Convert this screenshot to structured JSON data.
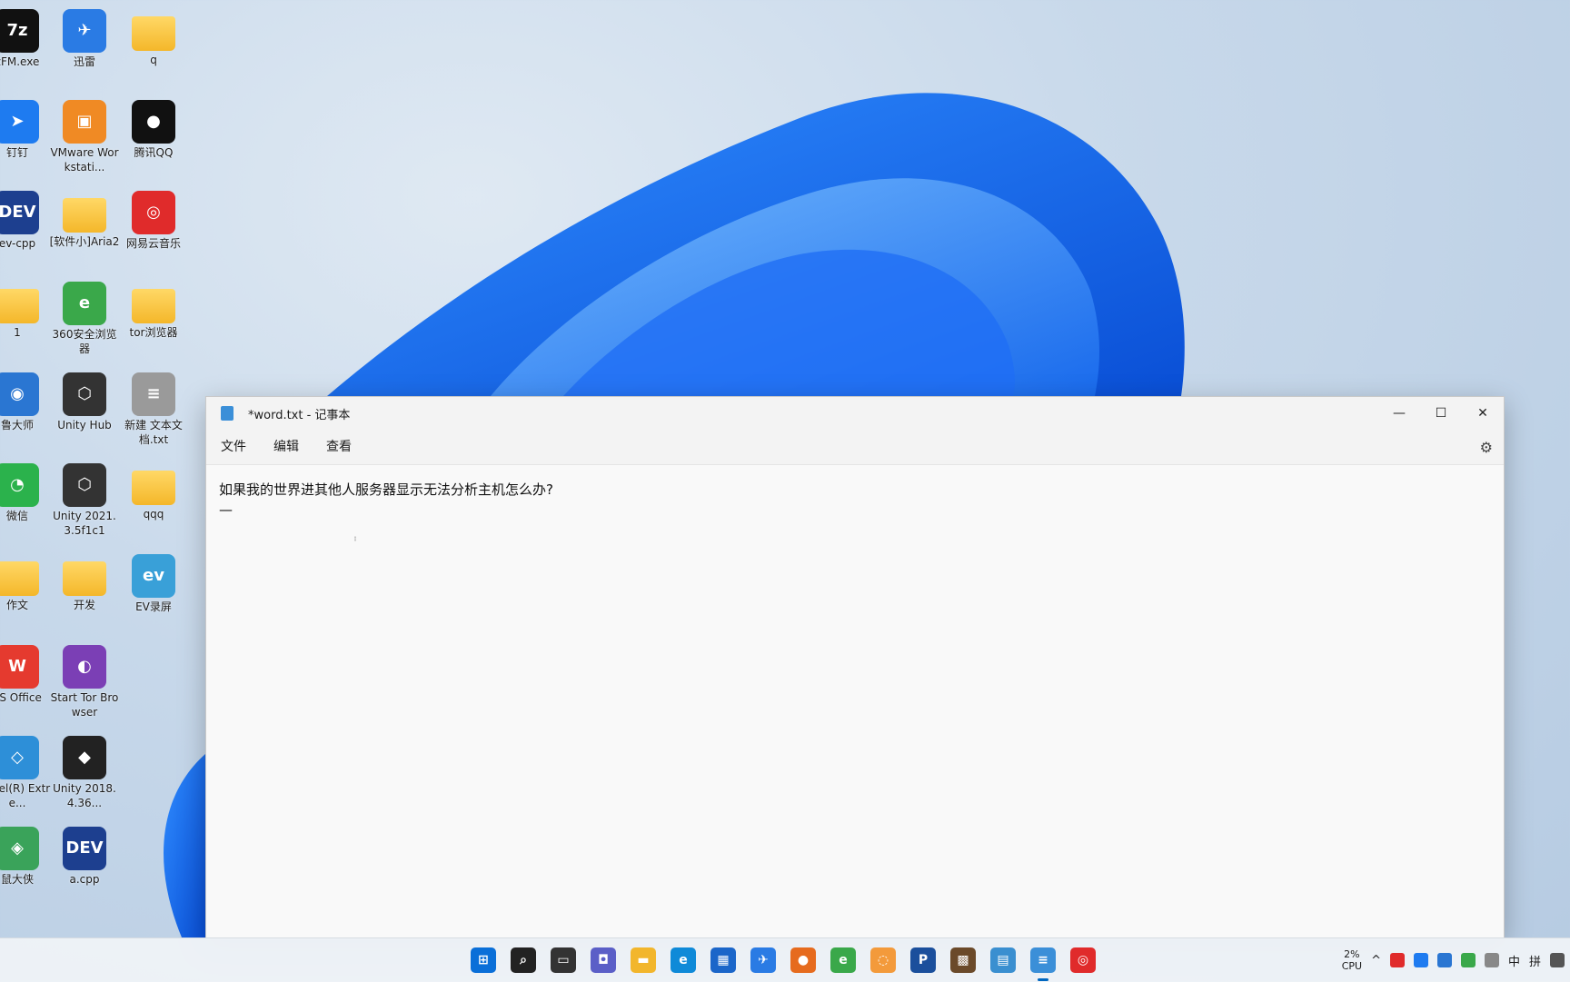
{
  "desktop": {
    "icons": [
      {
        "label": "zFM.exe",
        "glyph": "7z",
        "color": "#111111",
        "icon": "archive-icon"
      },
      {
        "label": "迅雷",
        "glyph": "✈",
        "color": "#2a7be4",
        "icon": "thunder-icon"
      },
      {
        "label": "q",
        "glyph": "",
        "color": "folder",
        "icon": "folder-icon"
      },
      {
        "label": "钉钉",
        "glyph": "➤",
        "color": "#1e7bf0",
        "icon": "dingtalk-icon"
      },
      {
        "label": "VMware Workstati...",
        "glyph": "▣",
        "color": "#f08a24",
        "icon": "vmware-icon"
      },
      {
        "label": "腾讯QQ",
        "glyph": "●",
        "color": "#111111",
        "icon": "qq-icon"
      },
      {
        "label": "ev-cpp",
        "glyph": "DEV",
        "color": "#1d3f8f",
        "icon": "devcpp-icon"
      },
      {
        "label": "[软件小]Aria2",
        "glyph": "",
        "color": "folder",
        "icon": "folder-icon"
      },
      {
        "label": "网易云音乐",
        "glyph": "◎",
        "color": "#e02b2b",
        "icon": "netease-music-icon"
      },
      {
        "label": "1",
        "glyph": "",
        "color": "folder",
        "icon": "folder-icon"
      },
      {
        "label": "360安全浏览器",
        "glyph": "e",
        "color": "#3aa84a",
        "icon": "browser-360-icon"
      },
      {
        "label": "tor浏览器",
        "glyph": "",
        "color": "folder",
        "icon": "folder-icon"
      },
      {
        "label": "鲁大师",
        "glyph": "◉",
        "color": "#2a76d2",
        "icon": "ludashi-icon"
      },
      {
        "label": "Unity Hub",
        "glyph": "⬡",
        "color": "#333333",
        "icon": "unity-hub-icon"
      },
      {
        "label": "新建 文本文档.txt",
        "glyph": "≡",
        "color": "#9a9a9a",
        "icon": "text-file-icon"
      },
      {
        "label": "微信",
        "glyph": "◔",
        "color": "#2bb24c",
        "icon": "wechat-icon"
      },
      {
        "label": "Unity 2021.3.5f1c1",
        "glyph": "⬡",
        "color": "#333333",
        "icon": "unity-icon"
      },
      {
        "label": "qqq",
        "glyph": "",
        "color": "folder",
        "icon": "folder-icon"
      },
      {
        "label": "作文",
        "glyph": "",
        "color": "folder",
        "icon": "folder-icon"
      },
      {
        "label": "开发",
        "glyph": "",
        "color": "folder",
        "icon": "folder-icon"
      },
      {
        "label": "EV录屏",
        "glyph": "ev",
        "color": "#39a0d8",
        "icon": "ev-recorder-icon"
      },
      {
        "label": "PS Office",
        "glyph": "W",
        "color": "#e53a2f",
        "icon": "wps-icon"
      },
      {
        "label": "Start Tor Browser",
        "glyph": "◐",
        "color": "#7b3fb5",
        "icon": "tor-icon"
      },
      {
        "label": "",
        "glyph": "",
        "color": "none",
        "icon": "empty-slot"
      },
      {
        "label": "Intel(R) Extre...",
        "glyph": "◇",
        "color": "#2d8fd8",
        "icon": "intel-icon"
      },
      {
        "label": "Unity 2018.4.36...",
        "glyph": "◆",
        "color": "#222222",
        "icon": "unity-2018-icon"
      },
      {
        "label": "",
        "glyph": "",
        "color": "none",
        "icon": "empty-slot"
      },
      {
        "label": "鼠大侠",
        "glyph": "◈",
        "color": "#3aa35a",
        "icon": "mouse-tool-icon"
      },
      {
        "label": "a.cpp",
        "glyph": "DEV",
        "color": "#1d3f8f",
        "icon": "cpp-file-icon"
      }
    ]
  },
  "notepad": {
    "title": "*word.txt - 记事本",
    "menus": [
      "文件",
      "编辑",
      "查看"
    ],
    "content_line1": "如果我的世界进其他人服务器显示无法分析主机怎么办?",
    "content_line2": "—",
    "controls": {
      "minimize": "—",
      "maximize": "☐",
      "close": "✕",
      "settings": "⚙"
    }
  },
  "taskbar": {
    "apps": [
      {
        "icon": "start-icon",
        "glyph": "⊞",
        "color": "#0a6fd8"
      },
      {
        "icon": "search-icon",
        "glyph": "⌕",
        "color": "#222222"
      },
      {
        "icon": "task-view-icon",
        "glyph": "▭",
        "color": "#333333"
      },
      {
        "icon": "chat-icon",
        "glyph": "◘",
        "color": "#5b5fc7"
      },
      {
        "icon": "file-explorer-icon",
        "glyph": "▬",
        "color": "#f2b62c"
      },
      {
        "icon": "edge-icon",
        "glyph": "e",
        "color": "#0f8ad8"
      },
      {
        "icon": "store-icon",
        "glyph": "▦",
        "color": "#1b66c9"
      },
      {
        "icon": "thunder-icon",
        "glyph": "✈",
        "color": "#2a7be4"
      },
      {
        "icon": "firefox-icon",
        "glyph": "●",
        "color": "#e66b1e"
      },
      {
        "icon": "browser-360-icon",
        "glyph": "e",
        "color": "#3aa84a"
      },
      {
        "icon": "orange-app-icon",
        "glyph": "◌",
        "color": "#f39a3b"
      },
      {
        "icon": "p-app-icon",
        "glyph": "P",
        "color": "#1b4f9c"
      },
      {
        "icon": "minecraft-icon",
        "glyph": "▩",
        "color": "#6b4a2a"
      },
      {
        "icon": "control-panel-icon",
        "glyph": "▤",
        "color": "#3a8fd0"
      },
      {
        "icon": "notepad-icon",
        "glyph": "≡",
        "color": "#3b8fd8"
      },
      {
        "icon": "netease-music-icon",
        "glyph": "◎",
        "color": "#e02b2b"
      }
    ],
    "active_index": 14,
    "cpu_percent": "2%",
    "cpu_label": "CPU",
    "tray_chevron": "^",
    "ime_mode": "中",
    "ime_pinyin": "拼"
  }
}
